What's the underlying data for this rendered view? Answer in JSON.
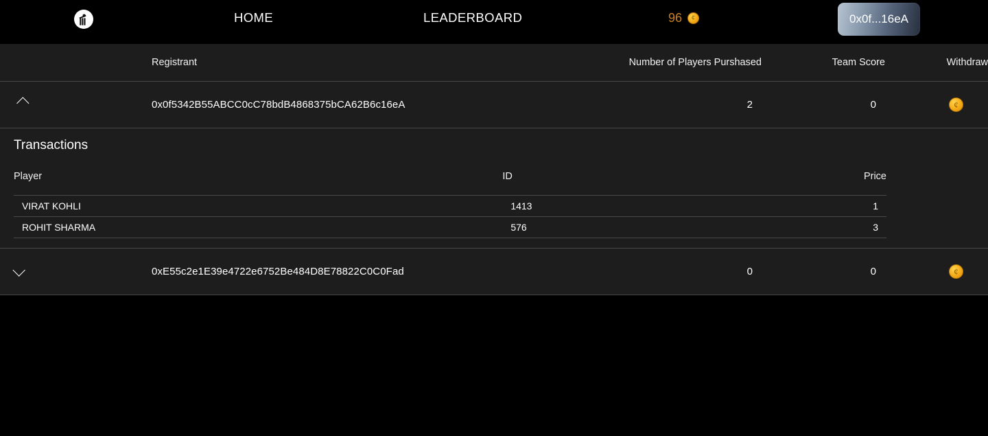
{
  "header": {
    "logo_name": "cricket-player-logo",
    "nav": [
      {
        "label": "HOME",
        "name": "nav-home"
      },
      {
        "label": "LEADERBOARD",
        "name": "nav-leaderboard"
      }
    ],
    "balance": {
      "value": "96",
      "coin_icon": "coin-icon",
      "coin_glyph": "¢"
    },
    "wallet_button": {
      "label": "0x0f...16eA"
    }
  },
  "colors": {
    "page_background": "#000000",
    "table_background": "#1d1d1d",
    "border": "#474747",
    "text": "#ffffff",
    "balance_accent": "#c8801f",
    "coin_gold": "#f5ab18"
  },
  "table": {
    "columns": [
      {
        "label": "",
        "name": "column-toggle"
      },
      {
        "label": "Registrant",
        "name": "column-registrant"
      },
      {
        "label": "Number of Players Purshased",
        "name": "column-players-purchased"
      },
      {
        "label": "Team Score",
        "name": "column-team-score"
      },
      {
        "label": "Withdraw",
        "name": "column-withdraw"
      }
    ],
    "rows": [
      {
        "address": "0x0f5342B55ABCC0cC78bdB4868375bCA62B6c16eA",
        "players_purchased": "2",
        "team_score": "0",
        "expanded": true,
        "toggle_icon": "chevron-up-icon",
        "withdraw_icon": "coin-icon"
      },
      {
        "address": "0xE55c2e1E39e4722e6752Be484D8E78822C0C0Fad",
        "players_purchased": "0",
        "team_score": "0",
        "expanded": false,
        "toggle_icon": "chevron-down-icon",
        "withdraw_icon": "coin-icon"
      }
    ]
  },
  "transactions": {
    "title": "Transactions",
    "columns": [
      {
        "label": "Player",
        "name": "tx-column-player"
      },
      {
        "label": "ID",
        "name": "tx-column-id"
      },
      {
        "label": "Price",
        "name": "tx-column-price"
      }
    ],
    "rows": [
      {
        "player": "VIRAT KOHLI",
        "id": "1413",
        "price": "1"
      },
      {
        "player": "ROHIT SHARMA",
        "id": "576",
        "price": "3"
      }
    ]
  }
}
